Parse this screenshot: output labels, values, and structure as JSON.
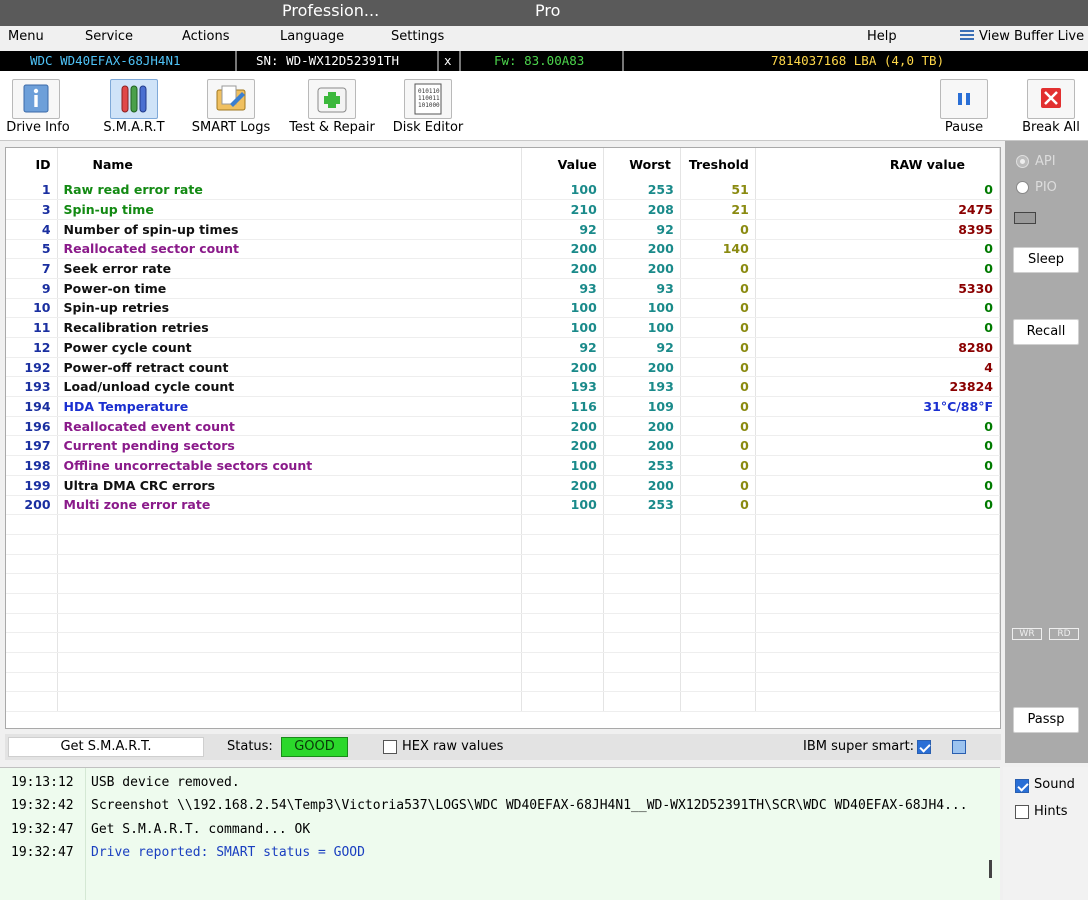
{
  "titlebar": {
    "title_left": "Profession...",
    "title_right": "Pro"
  },
  "menu": {
    "items": [
      "Menu",
      "Service",
      "Actions",
      "Language",
      "Settings",
      "Help"
    ],
    "view_buffer": "View Buffer Live"
  },
  "drive": {
    "model": "WDC WD40EFAX-68JH4N1",
    "serial": "SN: WD-WX12D52391TH",
    "close": "x",
    "firmware": "Fw: 83.00A83",
    "capacity": "7814037168 LBA (4,0 TB)"
  },
  "toolbar": {
    "drive_info": "Drive Info",
    "smart": "S.M.A.R.T",
    "smart_logs": "SMART Logs",
    "test_repair": "Test & Repair",
    "disk_editor": "Disk Editor",
    "pause": "Pause",
    "break_all": "Break All"
  },
  "table": {
    "headers": {
      "id": "ID",
      "name": "Name",
      "value": "Value",
      "worst": "Worst",
      "threshold": "Treshold",
      "raw": "RAW value"
    },
    "rows": [
      {
        "id": "1",
        "name": "Raw read error rate",
        "value": "100",
        "worst": "253",
        "threshold": "51",
        "raw": "0",
        "name_color": "green"
      },
      {
        "id": "3",
        "name": "Spin-up time",
        "value": "210",
        "worst": "208",
        "threshold": "21",
        "raw": "2475",
        "name_color": "green"
      },
      {
        "id": "4",
        "name": "Number of spin-up times",
        "value": "92",
        "worst": "92",
        "threshold": "0",
        "raw": "8395",
        "name_color": "black"
      },
      {
        "id": "5",
        "name": "Reallocated sector count",
        "value": "200",
        "worst": "200",
        "threshold": "140",
        "raw": "0",
        "name_color": "purple"
      },
      {
        "id": "7",
        "name": "Seek error rate",
        "value": "200",
        "worst": "200",
        "threshold": "0",
        "raw": "0",
        "name_color": "black"
      },
      {
        "id": "9",
        "name": "Power-on time",
        "value": "93",
        "worst": "93",
        "threshold": "0",
        "raw": "5330",
        "name_color": "black"
      },
      {
        "id": "10",
        "name": "Spin-up retries",
        "value": "100",
        "worst": "100",
        "threshold": "0",
        "raw": "0",
        "name_color": "black"
      },
      {
        "id": "11",
        "name": "Recalibration retries",
        "value": "100",
        "worst": "100",
        "threshold": "0",
        "raw": "0",
        "name_color": "black"
      },
      {
        "id": "12",
        "name": "Power cycle count",
        "value": "92",
        "worst": "92",
        "threshold": "0",
        "raw": "8280",
        "name_color": "black"
      },
      {
        "id": "192",
        "name": "Power-off retract count",
        "value": "200",
        "worst": "200",
        "threshold": "0",
        "raw": "4",
        "name_color": "black"
      },
      {
        "id": "193",
        "name": "Load/unload cycle count",
        "value": "193",
        "worst": "193",
        "threshold": "0",
        "raw": "23824",
        "name_color": "black"
      },
      {
        "id": "194",
        "name": "HDA Temperature",
        "value": "116",
        "worst": "109",
        "threshold": "0",
        "raw": "31°C/88°F",
        "name_color": "blue"
      },
      {
        "id": "196",
        "name": "Reallocated event count",
        "value": "200",
        "worst": "200",
        "threshold": "0",
        "raw": "0",
        "name_color": "purple"
      },
      {
        "id": "197",
        "name": "Current pending sectors",
        "value": "200",
        "worst": "200",
        "threshold": "0",
        "raw": "0",
        "name_color": "purple"
      },
      {
        "id": "198",
        "name": "Offline uncorrectable sectors count",
        "value": "100",
        "worst": "253",
        "threshold": "0",
        "raw": "0",
        "name_color": "purple"
      },
      {
        "id": "199",
        "name": "Ultra DMA CRC errors",
        "value": "200",
        "worst": "200",
        "threshold": "0",
        "raw": "0",
        "name_color": "black"
      },
      {
        "id": "200",
        "name": "Multi zone error rate",
        "value": "100",
        "worst": "253",
        "threshold": "0",
        "raw": "0",
        "name_color": "purple"
      }
    ]
  },
  "statusbar": {
    "get_smart": "Get S.M.A.R.T.",
    "status_label": "Status:",
    "status_value": "GOOD",
    "hex_label": "HEX raw values",
    "ibm_label": "IBM super smart:",
    "hex_checked": false,
    "ibm_checked": true
  },
  "side": {
    "api": "API",
    "pio": "PIO",
    "sleep": "Sleep",
    "recall": "Recall",
    "wr": "WR",
    "rd": "RD",
    "passp": "Passp"
  },
  "log": [
    {
      "time": "19:13:12",
      "message": "USB device removed.",
      "color": "#000000"
    },
    {
      "time": "19:32:42",
      "message": "Screenshot \\\\192.168.2.54\\Temp3\\Victoria537\\LOGS\\WDC WD40EFAX-68JH4N1__WD-WX12D52391TH\\SCR\\WDC WD40EFAX-68JH4...",
      "color": "#000000"
    },
    {
      "time": "19:32:47",
      "message": "Get S.M.A.R.T. command... OK",
      "color": "#000000"
    },
    {
      "time": "19:32:47",
      "message": "Drive reported: SMART status = GOOD",
      "color": "#1a3fc0"
    }
  ],
  "logside": {
    "sound": "Sound",
    "hints": "Hints",
    "sound_checked": true,
    "hints_checked": false
  },
  "colors": {
    "drive_model": "#4fc3f7",
    "serial": "#ffffff",
    "firmware": "#4cd44c",
    "capacity": "#ffd84a",
    "status_good": "#2bd82b"
  }
}
